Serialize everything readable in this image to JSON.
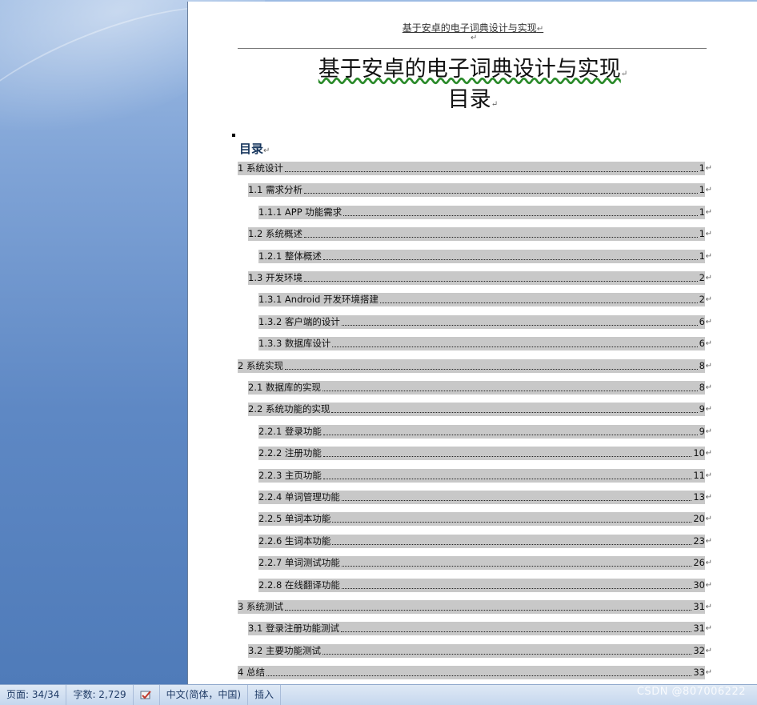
{
  "page_header": "基于安卓的电子词典设计与实现",
  "paragraph_mark": "↵",
  "document_title": "基于安卓的电子词典设计与实现",
  "toc_heading": "目录",
  "toc_label": "目录",
  "toc": [
    {
      "label": "1  系统设计",
      "page": "1",
      "level": 1
    },
    {
      "label": "1.1  需求分析",
      "page": "1",
      "level": 2
    },
    {
      "label": "1.1.1 APP 功能需求",
      "page": "1",
      "level": 3
    },
    {
      "label": "1.2  系统概述",
      "page": "1",
      "level": 2
    },
    {
      "label": "1.2.1  整体概述",
      "page": "1",
      "level": 3
    },
    {
      "label": "1.3  开发环境",
      "page": "2",
      "level": 2
    },
    {
      "label": "1.3.1 Android 开发环境搭建",
      "page": "2",
      "level": 3
    },
    {
      "label": "1.3.2 客户端的设计",
      "page": "6",
      "level": 3
    },
    {
      "label": "1.3.3  数据库设计",
      "page": "6",
      "level": 3
    },
    {
      "label": "2 系统实现",
      "page": "8",
      "level": 1
    },
    {
      "label": "2.1  数据库的实现",
      "page": "8",
      "level": 2
    },
    {
      "label": "2.2  系统功能的实现",
      "page": "9",
      "level": 2
    },
    {
      "label": "2.2.1 登录功能",
      "page": "9",
      "level": 3
    },
    {
      "label": "2.2.2 注册功能",
      "page": "10",
      "level": 3
    },
    {
      "label": "2.2.3 主页功能",
      "page": "11",
      "level": 3
    },
    {
      "label": "2.2.4 单词管理功能",
      "page": "13",
      "level": 3
    },
    {
      "label": "2.2.5 单词本功能",
      "page": "20",
      "level": 3
    },
    {
      "label": "2.2.6 生词本功能",
      "page": "23",
      "level": 3
    },
    {
      "label": "2.2.7 单词测试功能",
      "page": "26",
      "level": 3
    },
    {
      "label": "2.2.8 在线翻译功能",
      "page": "30",
      "level": 3
    },
    {
      "label": "3  系统测试",
      "page": "31",
      "level": 1
    },
    {
      "label": "3.1  登录注册功能测试",
      "page": "31",
      "level": 2
    },
    {
      "label": "3.2 主要功能测试",
      "page": "32",
      "level": 2
    },
    {
      "label": "4 总结",
      "page": "33",
      "level": 1
    }
  ],
  "statusbar": {
    "page": "页面: 34/34",
    "words": "字数: 2,729",
    "proofing_icon": "proofing-check-icon",
    "language": "中文(简体，中国)",
    "mode": "插入"
  },
  "watermark": "CSDN @807006222"
}
